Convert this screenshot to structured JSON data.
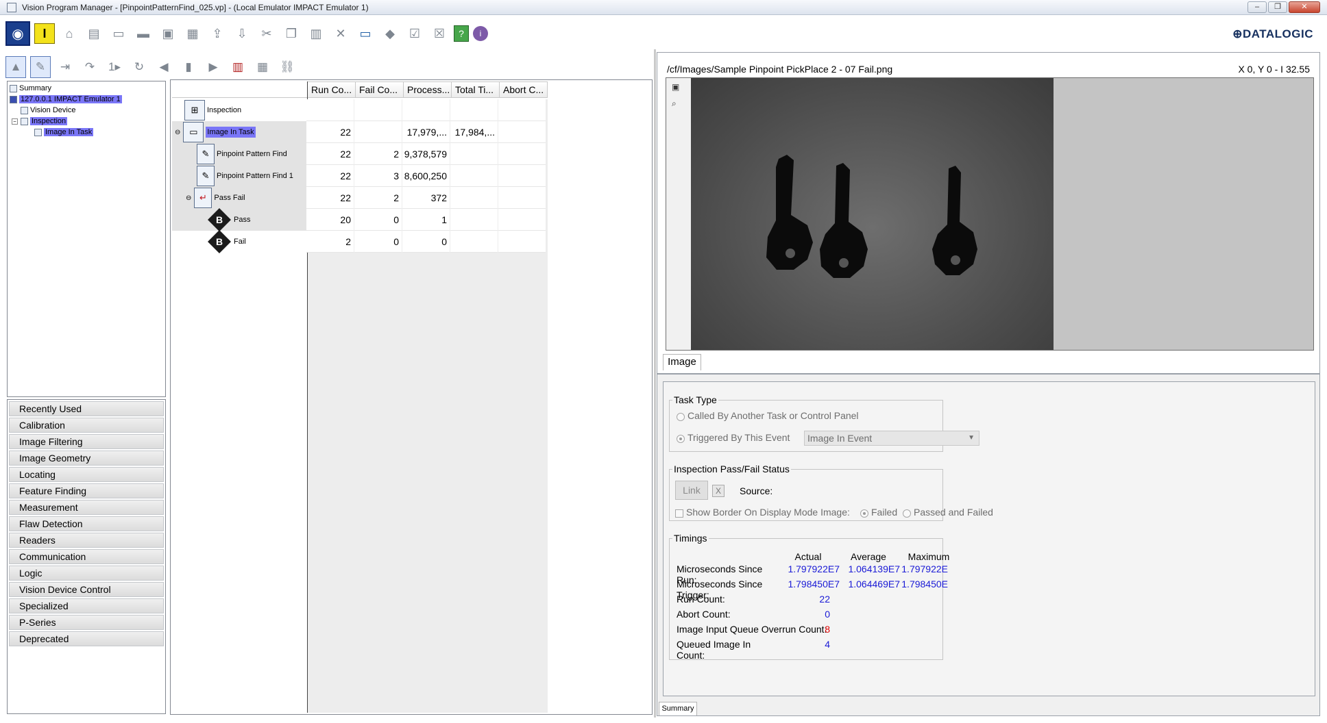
{
  "window": {
    "title": "Vision Program Manager - [PinpointPatternFind_025.vp] - (Local Emulator IMPACT Emulator 1)",
    "minimize": "–",
    "maximize": "❐",
    "close": "✕"
  },
  "brand": "⊕DATALOGIC",
  "toolbar1": {
    "icons": [
      "vision-manager-icon",
      "trigger-icon",
      "home-icon",
      "new-icon",
      "open-icon",
      "folder-icon",
      "save-icon",
      "save-all-icon",
      "upload-icon",
      "download-icon",
      "cut-icon",
      "copy-icon",
      "paste-icon",
      "delete-icon",
      "monitor-icon",
      "stamp-icon",
      "checklist-icon",
      "checklist-run-icon",
      "help-icon",
      "info-icon"
    ]
  },
  "toolbar2": {
    "icons": [
      "run-mode-icon",
      "edit-mode-icon",
      "step-into-icon",
      "step-over-icon",
      "step-one-icon",
      "step-out-icon",
      "previous-icon",
      "stop-icon",
      "next-icon",
      "reset-counters-icon",
      "reset-stats-icon",
      "link-icon"
    ]
  },
  "tree": {
    "items": [
      {
        "label": "Summary",
        "indent": 0
      },
      {
        "label": "127.0.0.1 IMPACT Emulator 1",
        "indent": 0,
        "selected": true
      },
      {
        "label": "Vision Device",
        "indent": 1
      },
      {
        "label": "Inspection",
        "indent": 1,
        "selected": true
      },
      {
        "label": "Image In Task",
        "indent": 2,
        "selected": true
      }
    ]
  },
  "tools": [
    "Recently Used",
    "Calibration",
    "Image Filtering",
    "Image Geometry",
    "Locating",
    "Feature Finding",
    "Measurement",
    "Flaw Detection",
    "Readers",
    "Communication",
    "Logic",
    "Vision Device Control",
    "Specialized",
    "P-Series",
    "Deprecated"
  ],
  "task_grid": {
    "columns": [
      "Run Co...",
      "Fail Co...",
      "Process...",
      "Total Ti...",
      "Abort C..."
    ],
    "rows": [
      {
        "name": "Inspection",
        "run": "",
        "fail": "",
        "process": "",
        "total": "",
        "abort": ""
      },
      {
        "name": "Image In Task",
        "run": "22",
        "fail": "",
        "process": "17,979,...",
        "total": "17,984,...",
        "abort": ""
      },
      {
        "name": "Pinpoint Pattern Find",
        "run": "22",
        "fail": "2",
        "process": "9,378,579",
        "total": "",
        "abort": ""
      },
      {
        "name": "Pinpoint Pattern Find 1",
        "run": "22",
        "fail": "3",
        "process": "8,600,250",
        "total": "",
        "abort": ""
      },
      {
        "name": "Pass Fail",
        "run": "22",
        "fail": "2",
        "process": "372",
        "total": "",
        "abort": ""
      },
      {
        "name": "Pass",
        "run": "20",
        "fail": "0",
        "process": "1",
        "total": "",
        "abort": ""
      },
      {
        "name": "Fail",
        "run": "2",
        "fail": "0",
        "process": "0",
        "total": "",
        "abort": ""
      }
    ]
  },
  "image": {
    "path": "/cf/Images/Sample Pinpoint PickPlace 2 - 07 Fail.png",
    "coords": "X 0,  Y 0  -  I 32.55",
    "tab": "Image"
  },
  "summary": {
    "tab": "Summary",
    "task_type": {
      "title": "Task Type",
      "option1": "Called By Another Task or Control Panel",
      "option2": "Triggered By This Event",
      "event_value": "Image In Event"
    },
    "passfail": {
      "title": "Inspection Pass/Fail Status",
      "link": "Link",
      "clear": "X",
      "source": "Source:",
      "show_border": "Show Border On Display Mode Image:",
      "failed": "Failed",
      "passed_and_failed": "Passed and Failed"
    },
    "timings": {
      "title": "Timings",
      "headers": [
        "Actual",
        "Average",
        "Maximum"
      ],
      "rows": [
        {
          "label": "Microseconds Since Run:",
          "actual": "1.797922E7",
          "average": "1.064139E7",
          "maximum": "1.797922E"
        },
        {
          "label": "Microseconds Since Trigger:",
          "actual": "1.798450E7",
          "average": "1.064469E7",
          "maximum": "1.798450E"
        },
        {
          "label": "Run Count:",
          "actual": "22",
          "average": "",
          "maximum": ""
        },
        {
          "label": "Abort Count:",
          "actual": "0",
          "average": "",
          "maximum": ""
        },
        {
          "label": "Image Input Queue Overrun Count:",
          "actual": "8",
          "average": "",
          "maximum": "",
          "alert": true
        },
        {
          "label": "Queued Image In Count:",
          "actual": "4",
          "average": "",
          "maximum": ""
        }
      ]
    }
  }
}
